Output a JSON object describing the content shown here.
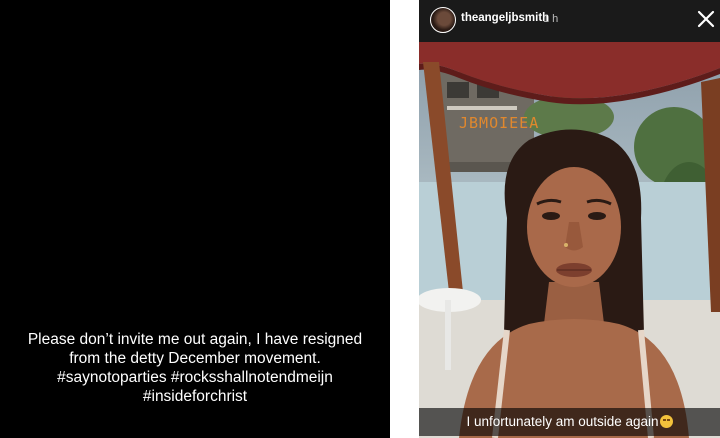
{
  "left_story": {
    "caption_lines": [
      "Please don’t invite me out again, I have resigned",
      "from the detty December movement.",
      "#saynotoparties #rocksshallnotendmeijn",
      "#insideforchrist"
    ]
  },
  "right_story": {
    "header": {
      "username": "theangeljbsmith",
      "timestamp": "1 h",
      "close_icon": "close-icon"
    },
    "photo_overlay_text": "JBMOIEEA",
    "caption": "I unfortunately am outside again",
    "caption_emoji": "pensive-face-emoji"
  }
}
